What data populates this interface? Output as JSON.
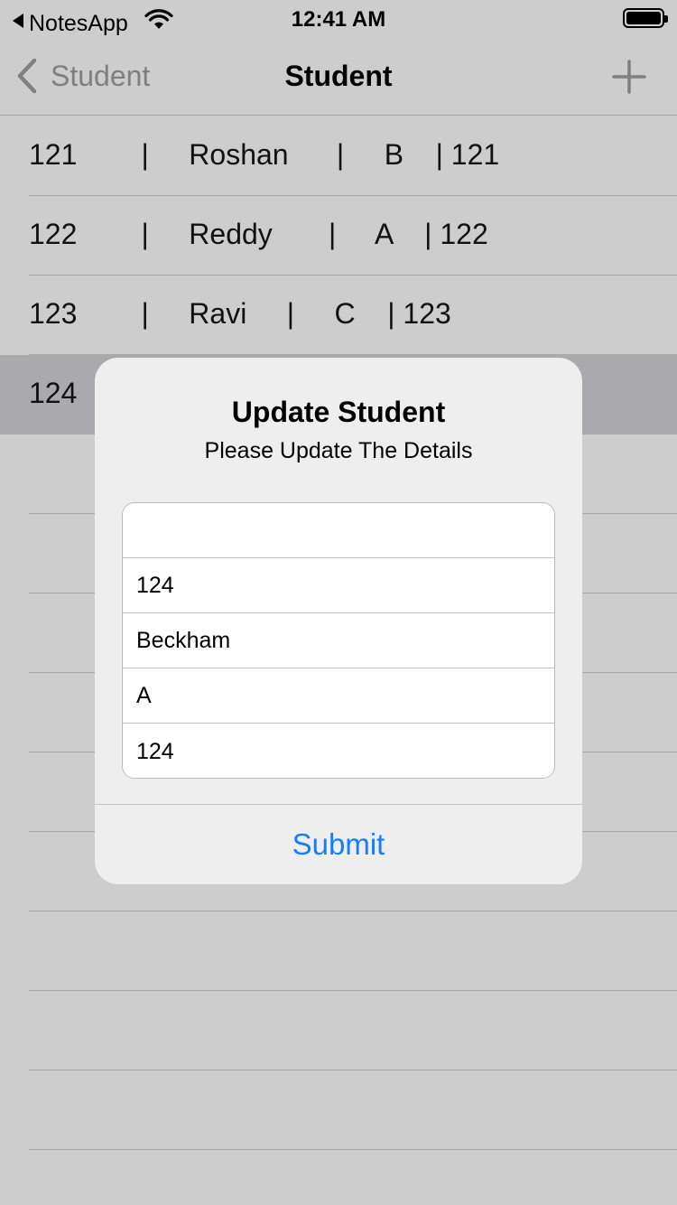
{
  "status_bar": {
    "back_app": "NotesApp",
    "time": "12:41 AM"
  },
  "nav": {
    "back_label": "Student",
    "title": "Student",
    "back_icon": "chevron-left-icon",
    "add_icon": "plus-icon"
  },
  "table": {
    "rows": [
      {
        "text": "121        |     Roshan      |     B    | 121"
      },
      {
        "text": "122        |     Reddy       |     A    | 122"
      },
      {
        "text": "123        |     Ravi     |     C    | 123"
      },
      {
        "text": "124"
      }
    ]
  },
  "alert": {
    "title": "Update Student",
    "message": "Please Update The Details",
    "fields": [
      {
        "value": ""
      },
      {
        "value": "124"
      },
      {
        "value": "Beckham"
      },
      {
        "value": "A"
      },
      {
        "value": "124"
      }
    ],
    "submit_label": "Submit"
  },
  "colors": {
    "accent": "#147efb",
    "background": "#cdcdcd",
    "selected_row": "#a9a9ae"
  }
}
